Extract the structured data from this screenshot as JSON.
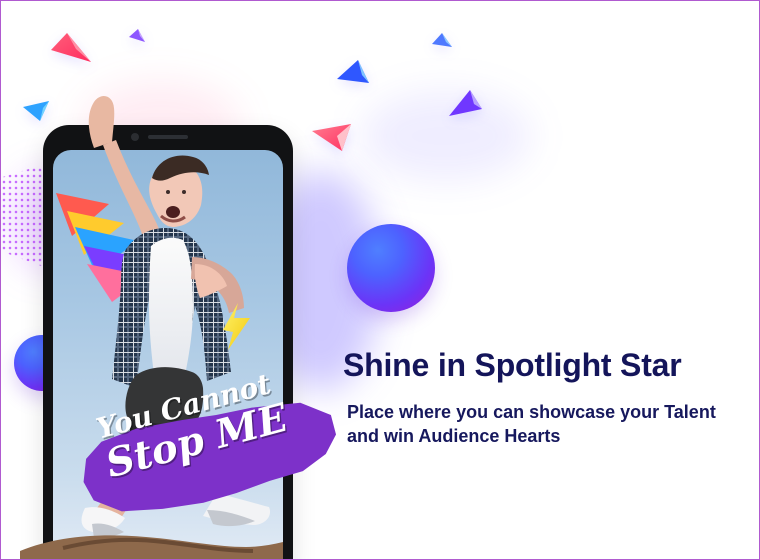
{
  "content": {
    "headline": "Shine in Spotlight Star",
    "description": "Place where you can showcase your Talent and win Audience Hearts"
  },
  "sticker": {
    "line1": "You Cannot",
    "line2": "Stop ME"
  },
  "colors": {
    "headline": "#14155a",
    "sticker": "#7d31c9",
    "accent_blue": "#4d62ff",
    "accent_purple": "#9a1ed8"
  },
  "icons": [
    "phone-mockup",
    "person-photo",
    "lightning-bolt-icon",
    "crystal-shard-icon"
  ]
}
